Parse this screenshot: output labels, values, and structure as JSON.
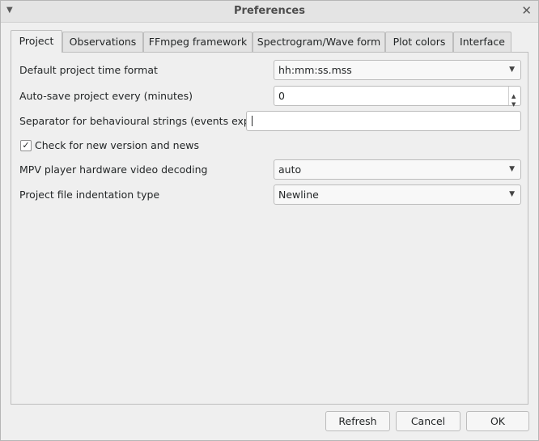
{
  "window": {
    "title": "Preferences"
  },
  "tabs": [
    {
      "label": "Project"
    },
    {
      "label": "Observations"
    },
    {
      "label": "FFmpeg framework"
    },
    {
      "label": "Spectrogram/Wave form"
    },
    {
      "label": "Plot colors"
    },
    {
      "label": "Interface"
    }
  ],
  "project": {
    "time_format": {
      "label": "Default project time format",
      "value": "hh:mm:ss.mss"
    },
    "autosave": {
      "label": "Auto-save project every (minutes)",
      "value": "0"
    },
    "separator": {
      "label": "Separator for behavioural strings (events export)",
      "value": ""
    },
    "check_version": {
      "label": "Check for new version and news",
      "checked": true
    },
    "mpv_decoding": {
      "label": "MPV player hardware video decoding",
      "value": "auto"
    },
    "indentation": {
      "label": "Project file indentation type",
      "value": "Newline"
    }
  },
  "buttons": {
    "refresh": "Refresh",
    "cancel": "Cancel",
    "ok": "OK"
  },
  "icons": {
    "menu": "chevron-down-icon",
    "close": "close-icon",
    "dropdown": "dropdown-arrow-icon",
    "check": "check-icon"
  }
}
